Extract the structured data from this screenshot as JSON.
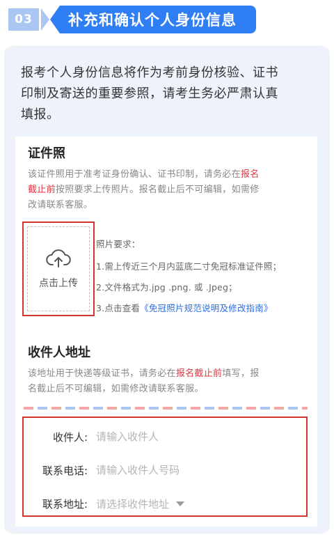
{
  "step": {
    "number": "03",
    "title": "补充和确认个人身份信息"
  },
  "intro": {
    "line1": "报考个人身份信息将作为考前身份核验、证书",
    "line2": "印制及寄送的重要参照，请考生务必严肃认真",
    "line3": "填报。"
  },
  "photo_section": {
    "title": "证件照",
    "desc_line1_a": "该证件照用于准考证身份确认、证书印制，请务必在",
    "desc_line1_hl": "报名",
    "desc_line2_hl": "截止前",
    "desc_line2_b": "按照要求上传照片。报名截止后不可编辑，如需修",
    "desc_line3": "改请联系客服。",
    "upload_label": "点击上传",
    "upload_icon": "cloud-upload-icon",
    "requirements_title": "照片要求：",
    "req1": "1.需上传近三个月内蓝底二寸免冠标准证件照；",
    "req2": "2.文件格式为.jpg .png. 或 .Jpeg；",
    "req3_a": "3.点击查看",
    "req3_link": "《免冠照片规范说明及修改指南》"
  },
  "address_section": {
    "title": "收件人地址",
    "desc_line1_a": "该地址用于快递等级证书，请务必在",
    "desc_line1_hl": "报名截止前",
    "desc_line1_b": "填写，报",
    "desc_line2": "名截止后不可编辑，如需修改请联系客服。"
  },
  "form": {
    "recipient_label": "收件人:",
    "recipient_placeholder": "请输入收件人",
    "phone_label": "联系电话:",
    "phone_placeholder": "请输入收件人号码",
    "address_label": "联系地址:",
    "address_placeholder": "请选择收件地址"
  },
  "colors": {
    "primary": "#2f7ef3",
    "highlight": "#e2343f",
    "annotation_border": "#d8322f",
    "link": "#2f6fe0"
  }
}
